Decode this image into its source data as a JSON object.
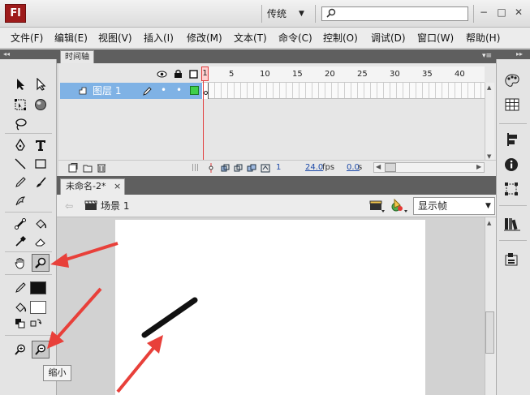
{
  "app": {
    "logo_text": "Fl",
    "workspace": "传统",
    "search": {
      "value": "",
      "placeholder": ""
    },
    "window_controls": {
      "minimize": "−",
      "restore": "□",
      "close": "✕"
    }
  },
  "menu": [
    "文件(F)",
    "编辑(E)",
    "视图(V)",
    "插入(I)",
    "修改(M)",
    "文本(T)",
    "命令(C)",
    "控制(O)",
    "调试(D)",
    "窗口(W)",
    "帮助(H)"
  ],
  "timeline": {
    "tab_label": "时间轴",
    "frame_numbers": [
      "1",
      "5",
      "10",
      "15",
      "20",
      "25",
      "30",
      "35",
      "40"
    ],
    "layer_name": "图层 1",
    "current_frame": "1",
    "fps": "24.0",
    "fps_unit": "fps",
    "elapsed": "0.0",
    "elapsed_unit": "s"
  },
  "document": {
    "tab_label": "未命名-2*",
    "close_symbol": "×",
    "scene": "场景 1",
    "zoom": "显示帧"
  },
  "toolbar": {
    "tooltip": "缩小"
  },
  "colors": {
    "annotation_arrow": "#e8403a",
    "panel_header": "#5f5f5f",
    "layer_selected": "#7fb2e5",
    "playhead": "#e23c3c",
    "stroke_color": "#111111",
    "fill_color": "#ffffff"
  }
}
